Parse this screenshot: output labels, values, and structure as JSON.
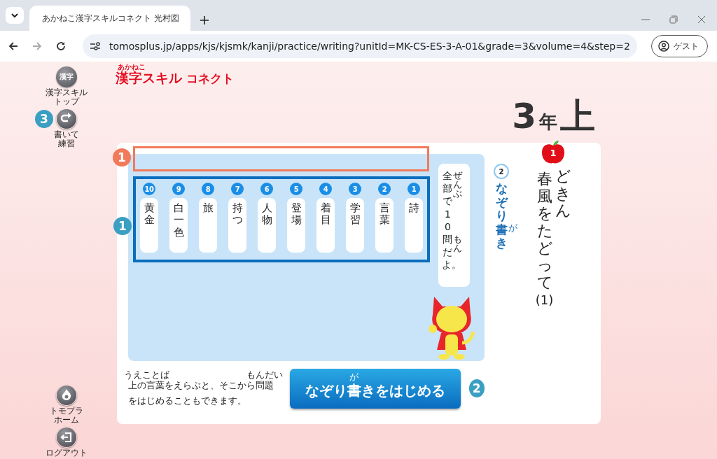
{
  "browser": {
    "tab_title": "あかねこ漢字スキルコネクト 光村図",
    "url": "tomosplus.jp/apps/kjs/kjsmk/kanji/practice/writing?unitId=MK-CS-ES-3-A-01&grade=3&volume=4&step=2",
    "profile": "ゲスト"
  },
  "sidebar": {
    "top": [
      {
        "kind": "kanji",
        "icon_text": "漢字",
        "label": [
          "漢字スキル",
          "トップ"
        ]
      },
      {
        "kind": "redo",
        "label": [
          "書いて",
          "練習"
        ],
        "marker": {
          "text": "3",
          "color": "#3a9fc2"
        }
      }
    ],
    "bottom": [
      {
        "kind": "home",
        "label": [
          "トモプラ",
          "ホーム"
        ]
      },
      {
        "kind": "logout",
        "label": [
          "ログアウト"
        ]
      }
    ]
  },
  "logo": {
    "small": "あかねこ",
    "main": "漢字スキル",
    "sub": "コネクト"
  },
  "grade": {
    "number": "3",
    "unit": "年",
    "volume": "上"
  },
  "range_box": {
    "marker": {
      "text": "1",
      "color": "#f2795a"
    }
  },
  "word_list": {
    "marker": {
      "text": "1",
      "color": "#3a9fc2"
    },
    "items": [
      {
        "number": "10",
        "text": "黄金"
      },
      {
        "number": "9",
        "text": "白一色"
      },
      {
        "number": "8",
        "text": "旅"
      },
      {
        "number": "7",
        "text": "持つ"
      },
      {
        "number": "6",
        "text": "人物"
      },
      {
        "number": "5",
        "text": "登場"
      },
      {
        "number": "4",
        "text": "着目"
      },
      {
        "number": "3",
        "text": "学習"
      },
      {
        "number": "2",
        "text": "言葉"
      },
      {
        "number": "1",
        "text": "詩"
      }
    ]
  },
  "note": [
    {
      "text": "全部",
      "ruby": "ぜんぶ"
    },
    {
      "text": "で10"
    },
    {
      "text": "問",
      "ruby": "もん"
    },
    {
      "text": "だよ。"
    }
  ],
  "hint": [
    {
      "text": "上",
      "ruby": "うえ"
    },
    {
      "text": "の"
    },
    {
      "text": "言葉",
      "ruby": "ことば"
    },
    {
      "text": "をえらぶと、そこから"
    },
    {
      "text": "問題",
      "ruby": "もんだい"
    },
    {
      "text": "をはじめることもできます。"
    }
  ],
  "start_button": {
    "label": [
      {
        "text": "なぞり"
      },
      {
        "text": "書",
        "ruby": "が"
      },
      {
        "text": "きをはじめる"
      }
    ],
    "marker": {
      "text": "2",
      "color": "#3a9fc2"
    }
  },
  "step": {
    "number": "2",
    "label": [
      {
        "text": "なぞり"
      },
      {
        "text": "書",
        "ruby": "が"
      },
      {
        "text": "き"
      }
    ]
  },
  "lesson": {
    "number": "1",
    "title_lines": [
      "春風をたどって",
      "どきん"
    ],
    "part": "(1)"
  }
}
